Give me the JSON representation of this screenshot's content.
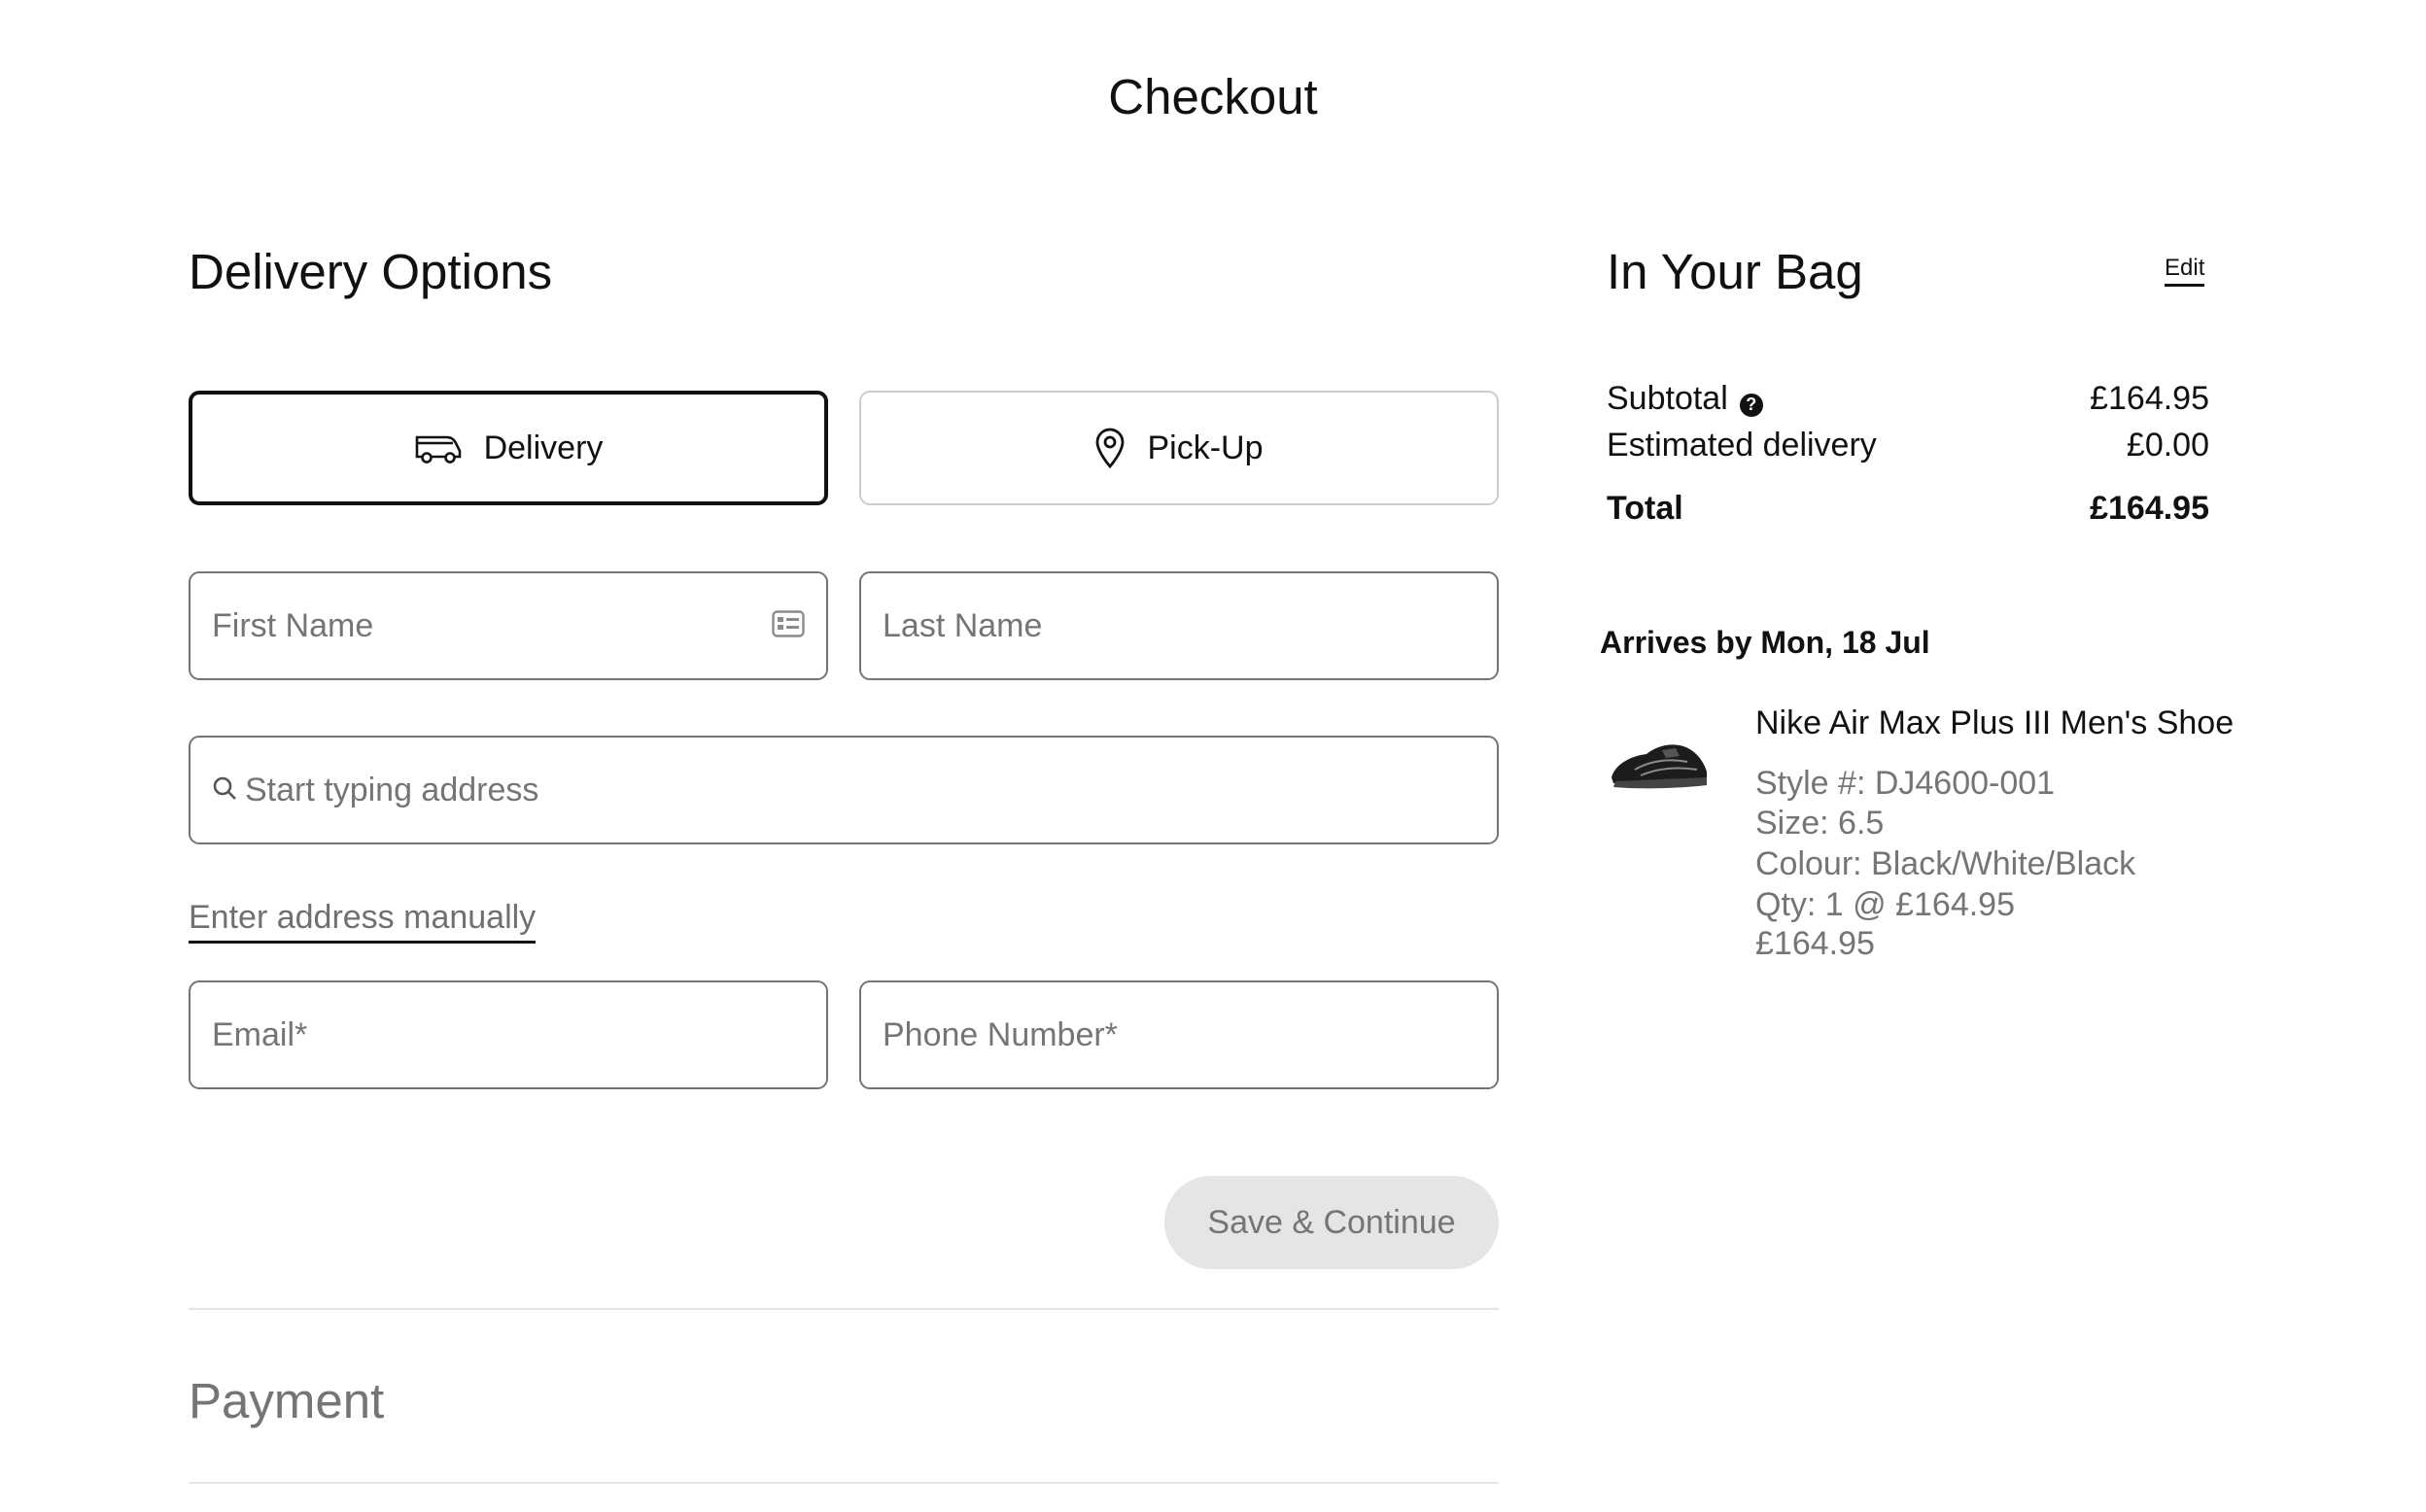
{
  "page": {
    "title": "Checkout"
  },
  "delivery": {
    "title": "Delivery Options",
    "options": [
      {
        "label": "Delivery",
        "icon": "van-icon",
        "selected": true
      },
      {
        "label": "Pick-Up",
        "icon": "location-pin-icon",
        "selected": false
      }
    ],
    "fields": {
      "first_name_placeholder": "First Name",
      "last_name_placeholder": "Last Name",
      "address_placeholder": "Start typing address",
      "email_placeholder": "Email*",
      "phone_placeholder": "Phone Number*"
    },
    "manual_link": "Enter address manually",
    "save_label": "Save & Continue"
  },
  "payment": {
    "title": "Payment"
  },
  "bag": {
    "title": "In Your Bag",
    "edit_label": "Edit",
    "subtotal_label": "Subtotal",
    "subtotal_value": "£164.95",
    "delivery_label": "Estimated delivery",
    "delivery_value": "£0.00",
    "total_label": "Total",
    "total_value": "£164.95",
    "arrival": "Arrives by Mon, 18 Jul",
    "item": {
      "name": "Nike Air Max Plus III Men's Shoe",
      "style": "Style #: DJ4600-001",
      "size": "Size: 6.5",
      "colour": "Colour: Black/White/Black",
      "qty": "Qty: 1 @ £164.95",
      "price": "£164.95"
    }
  },
  "colors": {
    "text": "#111111",
    "muted": "#757575",
    "border": "#757575",
    "divider": "#e5e5e5",
    "button_disabled_bg": "#e5e5e5"
  }
}
